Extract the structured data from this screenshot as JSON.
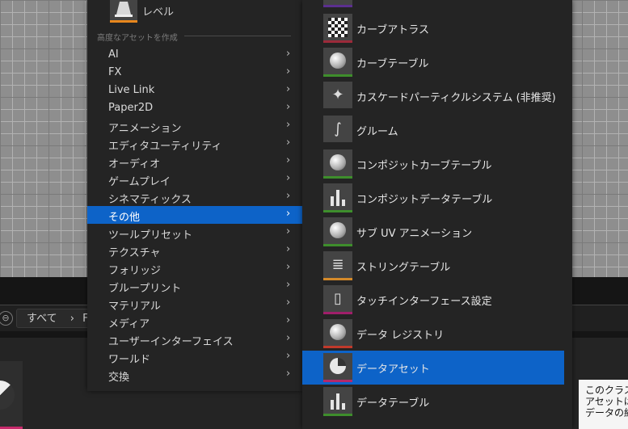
{
  "browser": {
    "nav_button": "⊖",
    "breadcrumb": "すべて",
    "breadcrumb_sep": "›",
    "crumb_partial": "F"
  },
  "left_menu": {
    "level_label": "レベル",
    "section_header": "高度なアセットを作成",
    "items": [
      {
        "label": "AI"
      },
      {
        "label": "FX"
      },
      {
        "label": "Live Link"
      },
      {
        "label": "Paper2D"
      },
      {
        "label": "アニメーション"
      },
      {
        "label": "エディタユーティリティ"
      },
      {
        "label": "オーディオ"
      },
      {
        "label": "ゲームプレイ"
      },
      {
        "label": "シネマティックス"
      },
      {
        "label": "その他",
        "selected": true
      },
      {
        "label": "ツールプリセット"
      },
      {
        "label": "テクスチャ"
      },
      {
        "label": "フォリッジ"
      },
      {
        "label": "ブループリント"
      },
      {
        "label": "マテリアル"
      },
      {
        "label": "メディア"
      },
      {
        "label": "ユーザーインターフェイス"
      },
      {
        "label": "ワールド"
      },
      {
        "label": "交換"
      }
    ],
    "arrow_glyph": "›"
  },
  "right_menu": {
    "items": [
      {
        "label": "カーブアトラス",
        "icon": "checker-icon",
        "accent": "#9c2a3a"
      },
      {
        "label": "カーブテーブル",
        "icon": "sphere-icon",
        "accent": "#3e8e2c"
      },
      {
        "label": "カスケードパーティクルシステム (非推奨)",
        "icon": "sparkle-icon",
        "accent": "#242424"
      },
      {
        "label": "グルーム",
        "icon": "hair-icon",
        "accent": "#242424"
      },
      {
        "label": "コンポジットカーブテーブル",
        "icon": "sphere-icon",
        "accent": "#3e8e2c"
      },
      {
        "label": "コンポジットデータテーブル",
        "icon": "bar-chart-icon",
        "accent": "#3e8e2c"
      },
      {
        "label": "サブ UV アニメーション",
        "icon": "sphere-icon",
        "accent": "#3e8e2c"
      },
      {
        "label": "ストリングテーブル",
        "icon": "list-doc-icon",
        "accent": "#d48a2a"
      },
      {
        "label": "タッチインターフェース設定",
        "icon": "phone-icon",
        "accent": "#a01e6a"
      },
      {
        "label": "データ レジストリ",
        "icon": "sphere-icon",
        "accent": "#c0392b"
      },
      {
        "label": "データアセット",
        "icon": "pie-icon",
        "accent": "#b4296a",
        "selected": true
      },
      {
        "label": "データテーブル",
        "icon": "bar-chart-icon",
        "accent": "#3e8e2c"
      }
    ]
  },
  "tooltip": {
    "line1": "このクラス",
    "line2": "アセットは",
    "line3": "データの組"
  }
}
